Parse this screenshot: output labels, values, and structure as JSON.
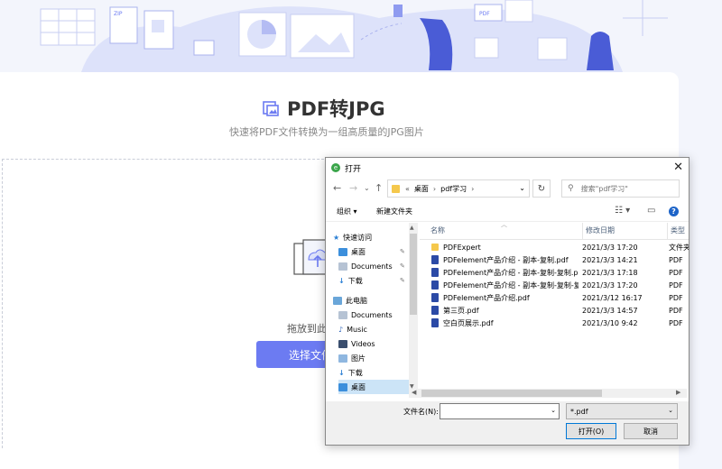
{
  "page": {
    "title": "PDF转JPG",
    "subtitle": "快速将PDF文件转换为一组高质量的JPG图片",
    "drop_text": "拖放到此",
    "select_button": "选择文件",
    "illustration_labels": {
      "zip": "ZIP",
      "pdf": "PDF"
    }
  },
  "dialog": {
    "title": "打开",
    "address": {
      "prefix": "«",
      "crumbs": [
        "桌面",
        "pdf学习"
      ]
    },
    "search_placeholder": "搜索\"pdf学习\"",
    "toolbar": {
      "organize": "组织 ▾",
      "new_folder": "新建文件夹"
    },
    "nav_items": [
      {
        "label": "快速访问",
        "icon": "star-icon"
      },
      {
        "label": "桌面",
        "icon": "desktop-icon",
        "pinned": true
      },
      {
        "label": "Documents",
        "icon": "documents-icon",
        "pinned": true
      },
      {
        "label": "下载",
        "icon": "download-icon",
        "pinned": true
      },
      {
        "label": "此电脑",
        "icon": "computer-icon"
      },
      {
        "label": "Documents",
        "icon": "documents-icon"
      },
      {
        "label": "Music",
        "icon": "music-icon"
      },
      {
        "label": "Videos",
        "icon": "videos-icon"
      },
      {
        "label": "图片",
        "icon": "pictures-icon"
      },
      {
        "label": "下载",
        "icon": "download-icon"
      },
      {
        "label": "桌面",
        "icon": "desktop-icon",
        "selected": true
      }
    ],
    "columns": {
      "name": "名称",
      "modified": "修改日期",
      "type": "类型"
    },
    "files": [
      {
        "name": "PDFExpert",
        "modified": "2021/3/3 17:20",
        "type": "文件夹",
        "kind": "folder"
      },
      {
        "name": "PDFelement产品介绍 - 副本-复制.pdf",
        "modified": "2021/3/3 14:21",
        "type": "PDF",
        "kind": "pdf"
      },
      {
        "name": "PDFelement产品介绍 - 副本-复制-复制.pdf",
        "modified": "2021/3/3 17:18",
        "type": "PDF",
        "kind": "pdf"
      },
      {
        "name": "PDFelement产品介绍 - 副本-复制-复制-复制.pdf",
        "modified": "2021/3/3 17:20",
        "type": "PDF",
        "kind": "pdf"
      },
      {
        "name": "PDFelement产品介绍.pdf",
        "modified": "2021/3/12 16:17",
        "type": "PDF",
        "kind": "pdf"
      },
      {
        "name": "第三页.pdf",
        "modified": "2021/3/3 14:57",
        "type": "PDF",
        "kind": "pdf"
      },
      {
        "name": "空白页展示.pdf",
        "modified": "2021/3/10 9:42",
        "type": "PDF",
        "kind": "pdf"
      }
    ],
    "filename_label": "文件名(N):",
    "filename_value": "",
    "filetype": "*.pdf",
    "open_button": "打开(O)",
    "cancel_button": "取消",
    "colors": {
      "accent": "#6c7bf2",
      "selection": "#cce4f7",
      "pdf_icon": "#2b4aa6",
      "folder_icon": "#f5c84c"
    }
  }
}
